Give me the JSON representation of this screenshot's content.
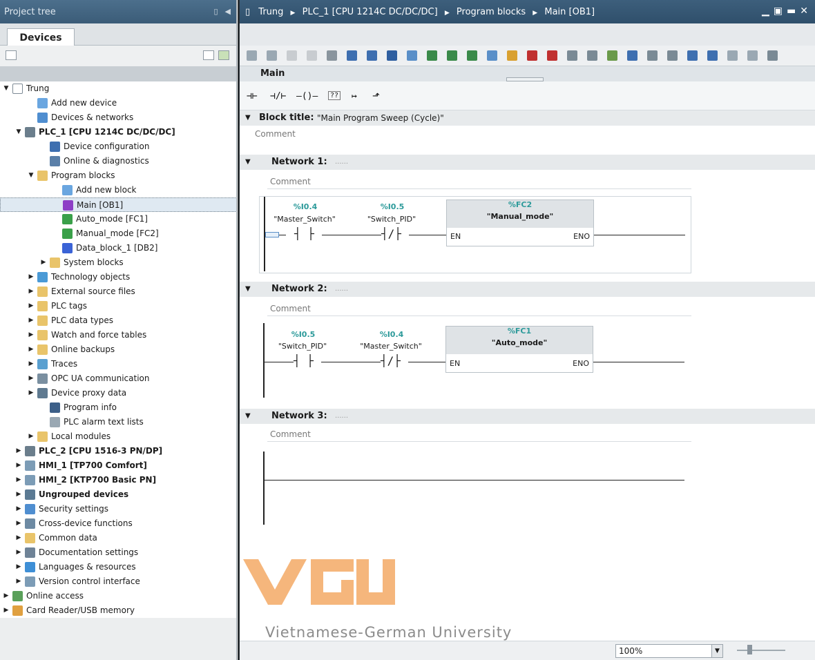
{
  "left_panel": {
    "title": "Project tree",
    "tab_label": "Devices"
  },
  "tree": [
    {
      "label": "Trung",
      "level": 0,
      "expander": "expanded",
      "icon": "project-icon",
      "bold": false,
      "selected": false
    },
    {
      "label": "Add new device",
      "level": 2,
      "expander": "none",
      "icon": "add-device-icon",
      "bold": false,
      "selected": false
    },
    {
      "label": "Devices & networks",
      "level": 2,
      "expander": "none",
      "icon": "network-icon",
      "bold": false,
      "selected": false
    },
    {
      "label": "PLC_1 [CPU 1214C DC/DC/DC]",
      "level": 1,
      "expander": "expanded",
      "icon": "plc-icon",
      "bold": true,
      "selected": false
    },
    {
      "label": "Device configuration",
      "level": 3,
      "expander": "none",
      "icon": "device-config-icon",
      "bold": false,
      "selected": false
    },
    {
      "label": "Online & diagnostics",
      "level": 3,
      "expander": "none",
      "icon": "diagnostics-icon",
      "bold": false,
      "selected": false
    },
    {
      "label": "Program blocks",
      "level": 2,
      "expander": "expanded",
      "icon": "folder-icon",
      "bold": false,
      "selected": false
    },
    {
      "label": "Add new block",
      "level": 4,
      "expander": "none",
      "icon": "add-block-icon",
      "bold": false,
      "selected": false
    },
    {
      "label": "Main [OB1]",
      "level": 4,
      "expander": "none",
      "icon": "ob-icon",
      "bold": false,
      "selected": true
    },
    {
      "label": "Auto_mode [FC1]",
      "level": 4,
      "expander": "none",
      "icon": "fc-icon",
      "bold": false,
      "selected": false
    },
    {
      "label": "Manual_mode [FC2]",
      "level": 4,
      "expander": "none",
      "icon": "fc-icon",
      "bold": false,
      "selected": false
    },
    {
      "label": "Data_block_1 [DB2]",
      "level": 4,
      "expander": "none",
      "icon": "db-icon",
      "bold": false,
      "selected": false
    },
    {
      "label": "System blocks",
      "level": 3,
      "expander": "collapsed",
      "icon": "folder-icon",
      "bold": false,
      "selected": false
    },
    {
      "label": "Technology objects",
      "level": 2,
      "expander": "collapsed",
      "icon": "tech-icon",
      "bold": false,
      "selected": false
    },
    {
      "label": "External source files",
      "level": 2,
      "expander": "collapsed",
      "icon": "folder-icon",
      "bold": false,
      "selected": false
    },
    {
      "label": "PLC tags",
      "level": 2,
      "expander": "collapsed",
      "icon": "folder-icon",
      "bold": false,
      "selected": false
    },
    {
      "label": "PLC data types",
      "level": 2,
      "expander": "collapsed",
      "icon": "folder-icon",
      "bold": false,
      "selected": false
    },
    {
      "label": "Watch and force tables",
      "level": 2,
      "expander": "collapsed",
      "icon": "folder-icon",
      "bold": false,
      "selected": false
    },
    {
      "label": "Online backups",
      "level": 2,
      "expander": "collapsed",
      "icon": "folder-icon",
      "bold": false,
      "selected": false
    },
    {
      "label": "Traces",
      "level": 2,
      "expander": "collapsed",
      "icon": "trace-icon",
      "bold": false,
      "selected": false
    },
    {
      "label": "OPC UA communication",
      "level": 2,
      "expander": "collapsed",
      "icon": "opc-icon",
      "bold": false,
      "selected": false
    },
    {
      "label": "Device proxy data",
      "level": 2,
      "expander": "collapsed",
      "icon": "proxy-icon",
      "bold": false,
      "selected": false
    },
    {
      "label": "Program info",
      "level": 3,
      "expander": "none",
      "icon": "info-icon",
      "bold": false,
      "selected": false
    },
    {
      "label": "PLC alarm text lists",
      "level": 3,
      "expander": "none",
      "icon": "list-icon",
      "bold": false,
      "selected": false
    },
    {
      "label": "Local modules",
      "level": 2,
      "expander": "collapsed",
      "icon": "folder-icon",
      "bold": false,
      "selected": false
    },
    {
      "label": "PLC_2 [CPU 1516-3 PN/DP]",
      "level": 1,
      "expander": "collapsed",
      "icon": "plc-icon",
      "bold": true,
      "selected": false
    },
    {
      "label": "HMI_1 [TP700 Comfort]",
      "level": 1,
      "expander": "collapsed",
      "icon": "hmi-icon",
      "bold": true,
      "selected": false
    },
    {
      "label": "HMI_2 [KTP700 Basic PN]",
      "level": 1,
      "expander": "collapsed",
      "icon": "hmi-icon",
      "bold": true,
      "selected": false
    },
    {
      "label": "Ungrouped devices",
      "level": 1,
      "expander": "collapsed",
      "icon": "ungrouped-icon",
      "bold": true,
      "selected": false
    },
    {
      "label": "Security settings",
      "level": 1,
      "expander": "collapsed",
      "icon": "security-icon",
      "bold": false,
      "selected": false
    },
    {
      "label": "Cross-device functions",
      "level": 1,
      "expander": "collapsed",
      "icon": "cross-device-icon",
      "bold": false,
      "selected": false
    },
    {
      "label": "Common data",
      "level": 1,
      "expander": "collapsed",
      "icon": "folder-icon",
      "bold": false,
      "selected": false
    },
    {
      "label": "Documentation settings",
      "level": 1,
      "expander": "collapsed",
      "icon": "doc-icon",
      "bold": false,
      "selected": false
    },
    {
      "label": "Languages & resources",
      "level": 1,
      "expander": "collapsed",
      "icon": "language-icon",
      "bold": false,
      "selected": false
    },
    {
      "label": "Version control interface",
      "level": 1,
      "expander": "collapsed",
      "icon": "version-icon",
      "bold": false,
      "selected": false
    },
    {
      "label": "Online access",
      "level": 0,
      "expander": "collapsed",
      "icon": "online-icon",
      "bold": false,
      "selected": false
    },
    {
      "label": "Card Reader/USB memory",
      "level": 0,
      "expander": "collapsed",
      "icon": "card-reader-icon",
      "bold": false,
      "selected": false
    }
  ],
  "editor": {
    "breadcrumb": [
      "Trung",
      "PLC_1 [CPU 1214C DC/DC/DC]",
      "Program blocks",
      "Main [OB1]"
    ],
    "block_name": "Main",
    "block_title_label": "Block title:",
    "block_title_value": "\"Main Program Sweep (Cycle)\"",
    "comment_placeholder": "Comment",
    "lad_instructions": [
      "⊣⊢",
      "⊣/⊢",
      "–()–",
      "??",
      "↦",
      "⬏"
    ]
  },
  "networks": [
    {
      "title": "Network 1:",
      "dots": "......",
      "comment": "Comment",
      "contacts": [
        {
          "address": "%I0.4",
          "tag": "\"Master_Switch\"",
          "type": "NO"
        },
        {
          "address": "%I0.5",
          "tag": "\"Switch_PID\"",
          "type": "NC"
        }
      ],
      "block": {
        "address": "%FC2",
        "name": "\"Manual_mode\"",
        "en": "EN",
        "eno": "ENO"
      }
    },
    {
      "title": "Network 2:",
      "dots": "......",
      "comment": "Comment",
      "contacts": [
        {
          "address": "%I0.5",
          "tag": "\"Switch_PID\"",
          "type": "NO"
        },
        {
          "address": "%I0.4",
          "tag": "\"Master_Switch\"",
          "type": "NC"
        }
      ],
      "block": {
        "address": "%FC1",
        "name": "\"Auto_mode\"",
        "en": "EN",
        "eno": "ENO"
      }
    },
    {
      "title": "Network 3:",
      "dots": "......",
      "comment": "Comment"
    }
  ],
  "status": {
    "zoom": "100%"
  },
  "watermark": {
    "logo_text": "VGU",
    "subtitle": "Vietnamese-German University",
    "color": "#f5b67c"
  },
  "colors": {
    "title_bar": "#3d5f7c",
    "address_teal": "#2c9a9a",
    "selection": "#dfe9f2"
  }
}
